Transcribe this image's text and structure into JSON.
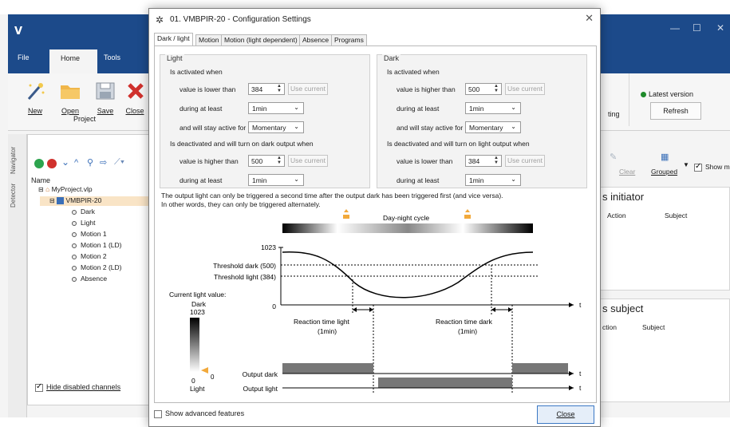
{
  "app": {
    "title_logo": "V",
    "tabs": [
      "File",
      "Home",
      "Tools"
    ],
    "ribbon_buttons": [
      "New",
      "Open",
      "Save",
      "Close"
    ],
    "group_label": "Project",
    "ribbon_partial_label": "ting",
    "latest_version": "Latest version",
    "refresh": "Refresh",
    "side_tabs": [
      "Navigator",
      "Detector"
    ],
    "tree_header": "Name",
    "tree": {
      "project": "MyProject.vlp",
      "module": "VMBPIR-20",
      "channels": [
        "Dark",
        "Light",
        "Motion 1",
        "Motion 1 (LD)",
        "Motion 2",
        "Motion 2 (LD)",
        "Absence"
      ]
    },
    "hide_disabled": "Hide disabled channels",
    "right_tools": {
      "clear": "Clear",
      "grouped": "Grouped",
      "show": "Show m"
    },
    "initiator_title": "s initiator",
    "initiator_cols": [
      "Action",
      "Subject"
    ],
    "subject_title": "s subject",
    "subject_cols": [
      "ction",
      "Subject"
    ]
  },
  "dialog": {
    "title": "01. VMBPIR-20 - Configuration Settings",
    "tabs": [
      "Dark / light",
      "Motion",
      "Motion (light dependent)",
      "Absence",
      "Programs"
    ],
    "light": {
      "title": "Light",
      "activated_when": "Is activated when",
      "row1_label": "value is lower than",
      "row1_value": "384",
      "use_current": "Use current",
      "row2_label": "during at least",
      "row2_value": "1min",
      "row3_label": "and will stay active for",
      "row3_value": "Momentary",
      "deactivated_when": "Is deactivated and will turn on dark output when",
      "row4_label": "value is higher than",
      "row4_value": "500",
      "row5_label": "during at least",
      "row5_value": "1min"
    },
    "dark": {
      "title": "Dark",
      "activated_when": "Is activated when",
      "row1_label": "value is higher than",
      "row1_value": "500",
      "use_current": "Use current",
      "row2_label": "during at least",
      "row2_value": "1min",
      "row3_label": "and will stay active for",
      "row3_value": "Momentary",
      "deactivated_when": "Is deactivated and will turn on light output when",
      "row4_label": "value is lower than",
      "row4_value": "384",
      "row5_label": "during at least",
      "row5_value": "1min"
    },
    "description_1": "The output light can only be triggered a second time after the output dark has been triggered first (and vice versa).",
    "description_2": "In other words, they can only be triggered alternately.",
    "diagram": {
      "cycle_label": "Day-night cycle",
      "y_max": "1023",
      "y_zero": "0",
      "threshold_dark": "Threshold dark (500)",
      "threshold_light": "Threshold light (384)",
      "current_light_value": "Current light value:",
      "scale_dark": "Dark",
      "scale_1023": "1023",
      "scale_0": "0",
      "scale_light": "Light",
      "indicator_value": "0",
      "reaction_light": "Reaction time light",
      "reaction_light_val": "(1min)",
      "reaction_dark": "Reaction time dark",
      "reaction_dark_val": "(1min)",
      "output_dark": "Output dark",
      "output_light": "Output light",
      "axis_t": "t"
    },
    "advanced": "Show advanced features",
    "close": "Close"
  }
}
